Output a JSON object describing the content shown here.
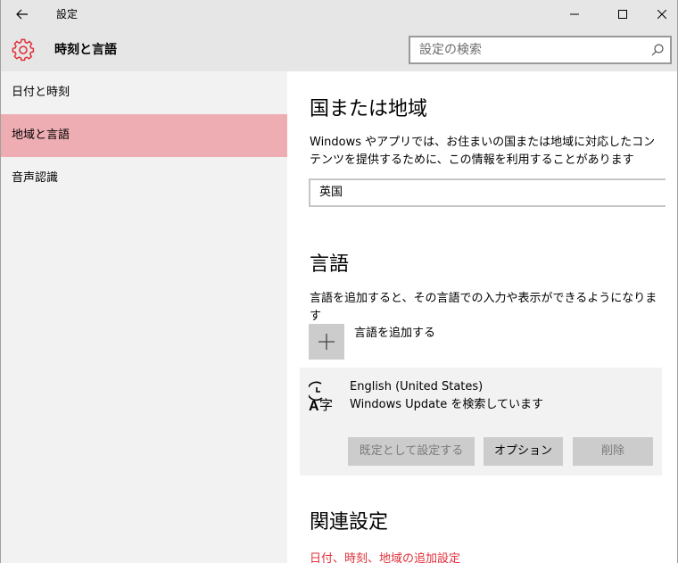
{
  "window": {
    "title": "設定",
    "controls": {
      "minimize": "—",
      "maximize": "☐",
      "close": "✕"
    }
  },
  "header": {
    "title": "時刻と言語",
    "search_placeholder": "設定の検索"
  },
  "sidebar": {
    "items": [
      {
        "label": "日付と時刻",
        "active": false
      },
      {
        "label": "地域と言語",
        "active": true
      },
      {
        "label": "音声認識",
        "active": false
      }
    ]
  },
  "main": {
    "region": {
      "heading": "国または地域",
      "description": "Windows やアプリでは、お住まいの国または地域に対応したコンテンツを提供するために、この情報を利用することがあります",
      "selected": "英国"
    },
    "language": {
      "heading": "言語",
      "description": "言語を追加すると、その言語での入力や表示ができるようになります",
      "add_label": "言語を追加する",
      "items": [
        {
          "name": "English (United States)",
          "status": "Windows Update を検索しています",
          "buttons": {
            "set_default": "既定として設定する",
            "options": "オプション",
            "remove": "削除"
          }
        }
      ]
    },
    "related": {
      "heading": "関連設定",
      "link": "日付、時刻、地域の追加設定"
    }
  },
  "colors": {
    "accent": "#e0303a",
    "sidebar_active": "#eeadb2",
    "sidebar_bg": "#f2f2f2",
    "titlebar_bg": "#e6e6e6"
  },
  "icons": {
    "back": "back-arrow-icon",
    "gear": "gear-icon",
    "search": "search-icon",
    "add": "plus-icon",
    "language": "language-icon"
  }
}
